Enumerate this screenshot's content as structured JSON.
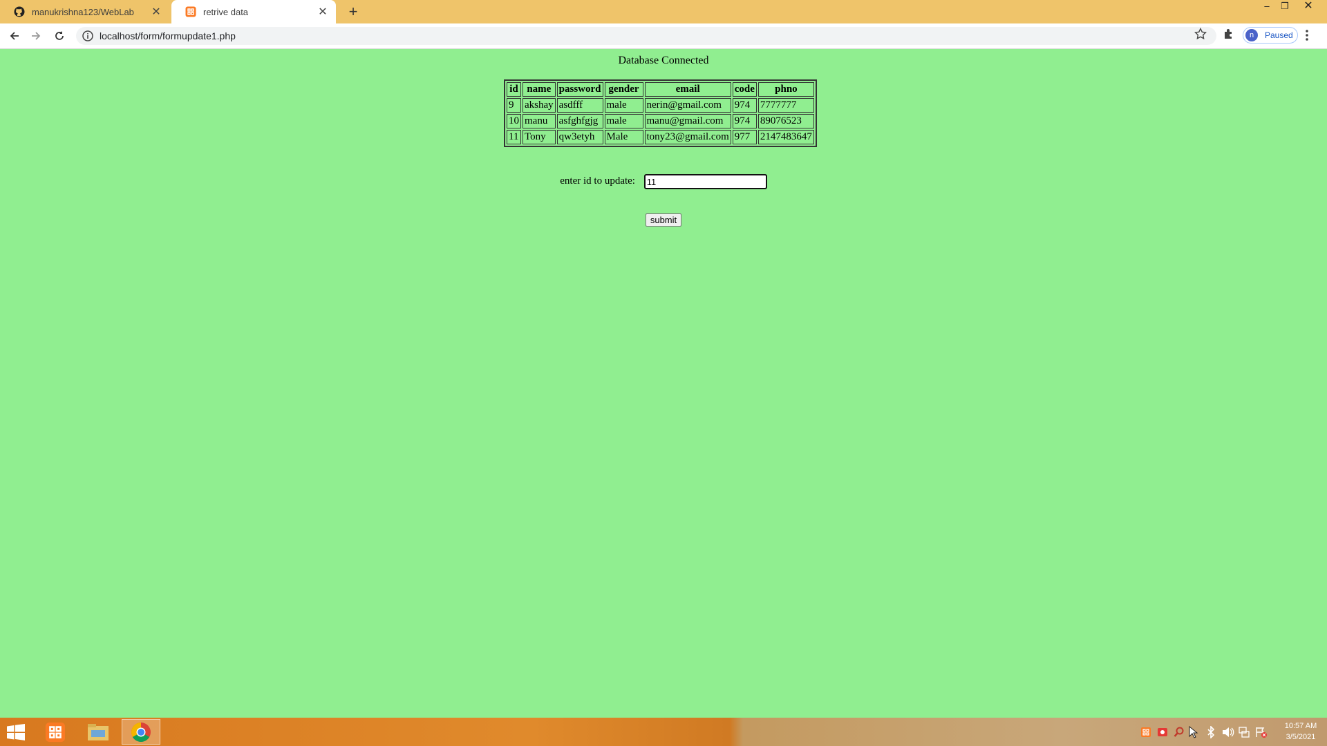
{
  "browser": {
    "tabs": [
      {
        "label": "manukrishna123/WebLab",
        "icon": "github-icon",
        "active": false
      },
      {
        "label": "retrive data",
        "icon": "xampp-icon",
        "active": true
      }
    ],
    "url": "localhost/form/formupdate1.php",
    "profile_status": "Paused",
    "profile_initial": "n"
  },
  "page": {
    "status_message": "Database Connected",
    "table": {
      "headers": [
        "id",
        "name",
        "password",
        "gender",
        "email",
        "code",
        "phno"
      ],
      "rows": [
        [
          "9",
          "akshay",
          "asdfff",
          "male",
          "nerin@gmail.com",
          "974",
          "7777777"
        ],
        [
          "10",
          "manu",
          "asfghfgjg",
          "male",
          "manu@gmail.com",
          "974",
          "89076523"
        ],
        [
          "11",
          "Tony",
          "qw3etyh",
          "Male",
          "tony23@gmail.com",
          "977",
          "2147483647"
        ]
      ]
    },
    "form": {
      "label": "enter id to update:",
      "value": "11",
      "submit_label": "submit"
    }
  },
  "taskbar": {
    "time": "10:57 AM",
    "date": "3/5/2021"
  },
  "colors": {
    "page_background": "#90ee90",
    "titlebar": "#efc46a"
  }
}
